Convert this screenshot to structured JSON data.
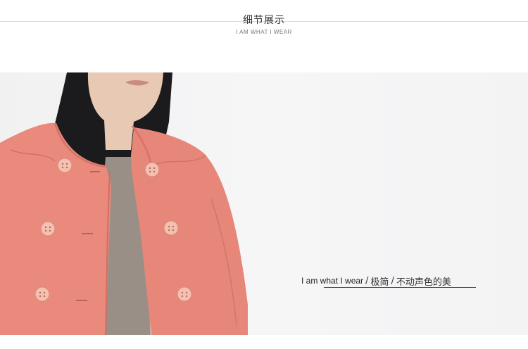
{
  "header": {
    "title": "细节展示",
    "subtitle": "I AM WHAT I WEAR"
  },
  "tagline": {
    "english": "I am what I wear",
    "separator": "/",
    "part1": "极简",
    "part2": "不动声色的美"
  },
  "colors": {
    "coat": "#e98a7d",
    "background": "#f3f3f4",
    "button": "#f4c0b0"
  }
}
